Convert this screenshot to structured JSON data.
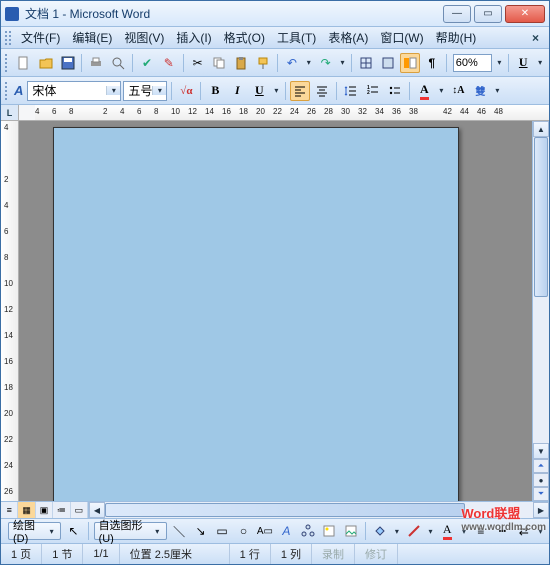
{
  "title": "文档 1 - Microsoft Word",
  "menu": {
    "file": "文件(F)",
    "edit": "编辑(E)",
    "view": "视图(V)",
    "insert": "插入(I)",
    "format": "格式(O)",
    "tools": "工具(T)",
    "table": "表格(A)",
    "window": "窗口(W)",
    "help": "帮助(H)"
  },
  "zoom": "60%",
  "font": {
    "name": "宋体",
    "size": "五号"
  },
  "ruler_h": [
    4,
    6,
    8,
    "",
    2,
    4,
    6,
    8,
    10,
    12,
    14,
    16,
    18,
    20,
    22,
    24,
    26,
    28,
    30,
    32,
    34,
    36,
    38,
    "",
    42,
    44,
    46,
    48
  ],
  "ruler_v": [
    4,
    "",
    2,
    4,
    6,
    8,
    10,
    12,
    14,
    16,
    18,
    20,
    22,
    24,
    26
  ],
  "draw": {
    "label": "绘图(D)",
    "autoshape": "自选图形(U)"
  },
  "status": {
    "page": "1 页",
    "section": "1 节",
    "pages": "1/1",
    "pos": "位置 2.5厘米",
    "line": "1 行",
    "col": "1 列",
    "rec": "录制",
    "trk": "修订"
  },
  "watermark": {
    "line1": "Word联盟",
    "line2": "www.wordlm.com"
  }
}
